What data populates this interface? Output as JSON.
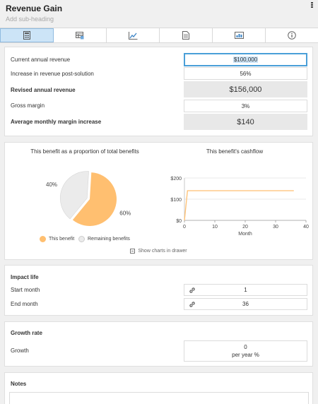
{
  "header": {
    "title": "Revenue Gain",
    "subheading": "Add sub-heading"
  },
  "tabs": [
    {
      "icon": "calculator-icon",
      "active": true
    },
    {
      "icon": "table-edit-icon",
      "active": false
    },
    {
      "icon": "line-chart-icon",
      "active": false
    },
    {
      "icon": "document-icon",
      "active": false
    },
    {
      "icon": "presentation-chart-icon",
      "active": false
    },
    {
      "icon": "info-icon",
      "active": false
    }
  ],
  "revenue": {
    "current_label": "Current annual revenue",
    "current_value": "$100,000",
    "increase_label": "Increase in revenue post-solution",
    "increase_value": "56%",
    "revised_label": "Revised annual revenue",
    "revised_value": "$156,000",
    "margin_label": "Gross margin",
    "margin_value": "3%",
    "avg_label": "Average monthly margin increase",
    "avg_value": "$140"
  },
  "charts": {
    "pie_title": "This benefit as a proportion of total benefits",
    "line_title": "This benefit's cashflow",
    "legend_this": "This benefit",
    "legend_remaining": "Remaining benefits",
    "drawer_label": "Show charts in drawer"
  },
  "chart_data": [
    {
      "type": "pie",
      "title": "This benefit as a proportion of total benefits",
      "categories": [
        "This benefit",
        "Remaining benefits"
      ],
      "values": [
        60,
        40
      ],
      "labels": [
        "60%",
        "40%"
      ],
      "colors": [
        "#ffbf70",
        "#ebebeb"
      ],
      "legend": "bottom"
    },
    {
      "type": "line",
      "title": "This benefit's cashflow",
      "xlabel": "Month",
      "ylabel": "",
      "xlim": [
        0,
        40
      ],
      "ylim": [
        0,
        200
      ],
      "xticks": [
        0,
        10,
        20,
        30,
        40
      ],
      "yticks": [
        0,
        100,
        200
      ],
      "ytick_labels": [
        "$0",
        "$100",
        "$200"
      ],
      "series": [
        {
          "x": [
            0,
            1,
            36
          ],
          "y": [
            0,
            140,
            140
          ],
          "color": "#ffbf70"
        }
      ],
      "grid": true
    }
  ],
  "impact": {
    "title": "Impact life",
    "start_label": "Start month",
    "start_value": "1",
    "end_label": "End month",
    "end_value": "36"
  },
  "growth": {
    "title": "Growth rate",
    "growth_label": "Growth",
    "growth_value": "0",
    "growth_unit": "per year %"
  },
  "notes": {
    "title": "Notes"
  }
}
